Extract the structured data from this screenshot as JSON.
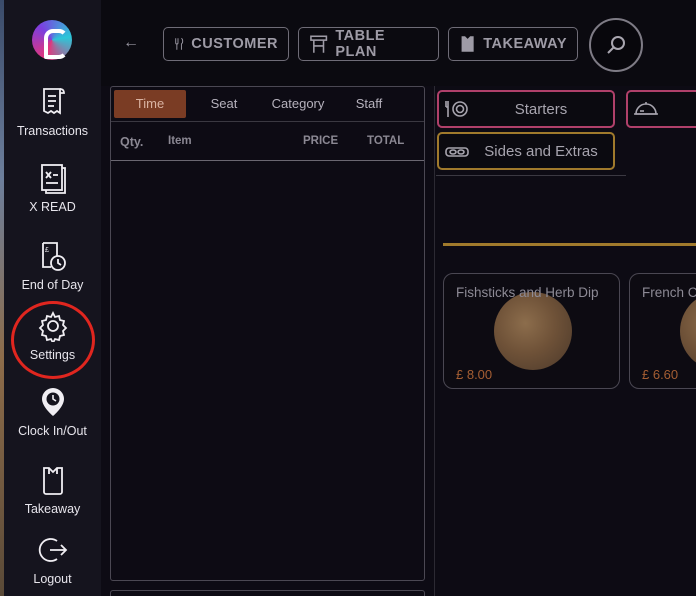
{
  "sidebar": {
    "items": [
      {
        "label": "Transactions",
        "icon": "receipt-icon"
      },
      {
        "label": "X READ",
        "icon": "x-report-icon"
      },
      {
        "label": "End of Day",
        "icon": "end-of-day-icon"
      },
      {
        "label": "Settings",
        "icon": "gear-icon"
      },
      {
        "label": "Clock In/Out",
        "icon": "clock-pin-icon"
      },
      {
        "label": "Takeaway",
        "icon": "takeaway-bag-icon"
      },
      {
        "label": "Logout",
        "icon": "logout-icon"
      }
    ],
    "highlight_color": "#e0261f"
  },
  "topbar": {
    "customer": "CUSTOMER",
    "table_plan": "TABLE PLAN",
    "takeaway": "TAKEAWAY"
  },
  "order": {
    "tabs": [
      "Time",
      "Seat",
      "Category",
      "Staff"
    ],
    "active_tab": "Time",
    "columns": {
      "qty": "Qty.",
      "item": "Item",
      "price": "PRICE",
      "total": "TOTAL"
    }
  },
  "categories": [
    {
      "label": "Starters",
      "border": "#b0406a"
    },
    {
      "label": "Sides and Extras",
      "border": "#a07a2c"
    }
  ],
  "products": [
    {
      "name": "Fishsticks and Herb Dip",
      "price": "£ 8.00"
    },
    {
      "name": "French C",
      "price": "£ 6.60"
    }
  ],
  "colors": {
    "accent_gold": "#a07a2c",
    "active_tab": "#7a3c24",
    "price": "#a55e33"
  }
}
